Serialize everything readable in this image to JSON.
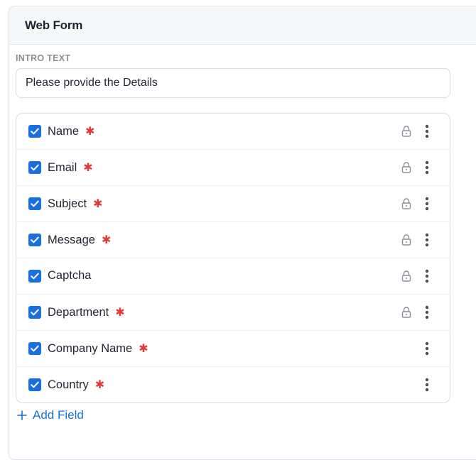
{
  "panel": {
    "title": "Web Form"
  },
  "intro": {
    "label": "INTRO TEXT",
    "value": "Please provide the Details"
  },
  "fields": [
    {
      "label": "Name",
      "required": true,
      "locked": true,
      "checked": true
    },
    {
      "label": "Email",
      "required": true,
      "locked": true,
      "checked": true
    },
    {
      "label": "Subject",
      "required": true,
      "locked": true,
      "checked": true
    },
    {
      "label": "Message",
      "required": true,
      "locked": true,
      "checked": true
    },
    {
      "label": "Captcha",
      "required": false,
      "locked": true,
      "checked": true
    },
    {
      "label": "Department",
      "required": true,
      "locked": true,
      "checked": true
    },
    {
      "label": "Company Name",
      "required": true,
      "locked": false,
      "checked": true
    },
    {
      "label": "Country",
      "required": true,
      "locked": false,
      "checked": true
    }
  ],
  "required_symbol": "✱",
  "add_field": {
    "label": "Add Field"
  },
  "colors": {
    "accent": "#1a6fe0",
    "required": "#e03b3b",
    "icon_gray": "#8a8f99"
  },
  "icons": {
    "checkbox": "check-icon",
    "lock": "lock-icon",
    "menu": "more-vertical-icon",
    "add": "plus-icon"
  }
}
